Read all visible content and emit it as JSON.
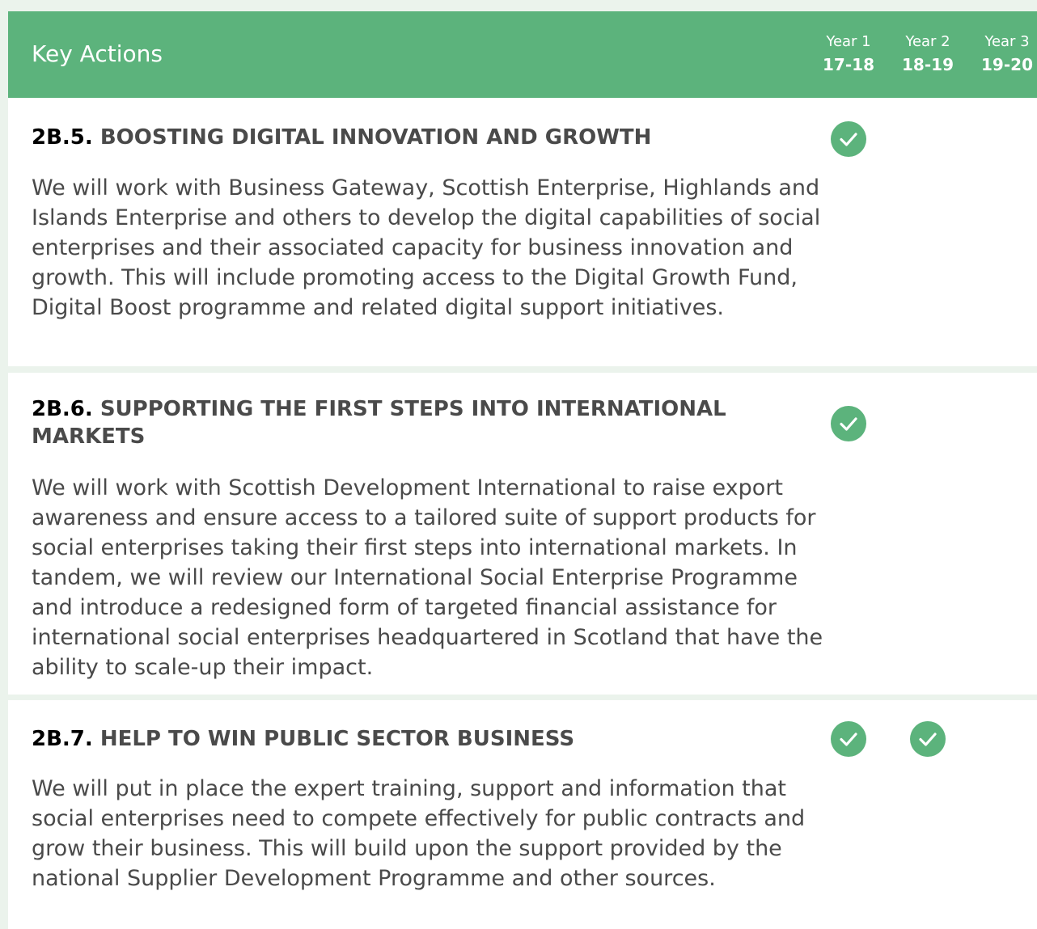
{
  "header": {
    "title": "Key Actions",
    "years": [
      {
        "label": "Year 1",
        "range": "17-18"
      },
      {
        "label": "Year 2",
        "range": "18-19"
      },
      {
        "label": "Year 3",
        "range": "19-20"
      }
    ]
  },
  "actions": [
    {
      "code": "2B.5.",
      "title": "BOOSTING DIGITAL INNOVATION AND GROWTH",
      "body": "We will work with Business Gateway, Scottish Enterprise, Highlands and Islands Enterprise and others to develop the digital capabilities of social enterprises and their associated capacity for business innovation and growth. This will include promoting access to the Digital Growth Fund, Digital Boost programme and related digital support initiatives.",
      "years_checked": [
        "Year 1"
      ]
    },
    {
      "code": "2B.6.",
      "title": "SUPPORTING THE FIRST STEPS INTO INTERNATIONAL MARKETS",
      "body": "We will work with Scottish Development International to raise export awareness and ensure access to a tailored suite of support products for social enterprises taking their first steps into international markets. In tandem, we will review our International Social Enterprise Programme and introduce a redesigned form of targeted financial assistance for international social enterprises headquartered in Scotland that have the ability to scale-up their impact.",
      "years_checked": [
        "Year 1"
      ]
    },
    {
      "code": "2B.7.",
      "title": "HELP TO WIN PUBLIC SECTOR BUSINESS",
      "body": "We will put in place the expert training, support and information that social enterprises need to compete effectively for public contracts and grow their business. This will build upon the support provided by the national Supplier Development Programme and other sources.",
      "years_checked": [
        "Year 1",
        "Year 2"
      ]
    }
  ],
  "colors": {
    "accent": "#5cb37c",
    "page_background": "#ebf3ec",
    "body_text": "#4a4a4a",
    "header_text": "#ffffff"
  },
  "icons": {
    "check": "check-circle-icon"
  }
}
